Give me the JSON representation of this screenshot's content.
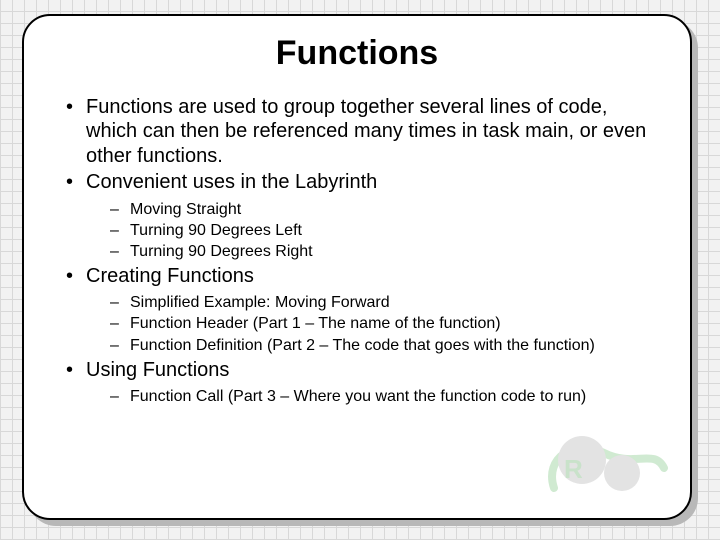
{
  "title": "Functions",
  "bullets": [
    {
      "text": "Functions are used to group together several lines of code, which can then be referenced many times in task main, or even other functions.",
      "children": []
    },
    {
      "text": "Convenient uses in the Labyrinth",
      "children": [
        "Moving Straight",
        "Turning 90 Degrees Left",
        "Turning 90 Degrees Right"
      ]
    },
    {
      "text": "Creating Functions",
      "children": [
        "Simplified Example: Moving Forward",
        "Function Header (Part 1 – The name of the function)",
        "Function Definition (Part 2 – The code that goes with the function)"
      ]
    },
    {
      "text": "Using Functions",
      "children": [
        "Function Call (Part 3 – Where you want the function code to run)"
      ]
    }
  ]
}
